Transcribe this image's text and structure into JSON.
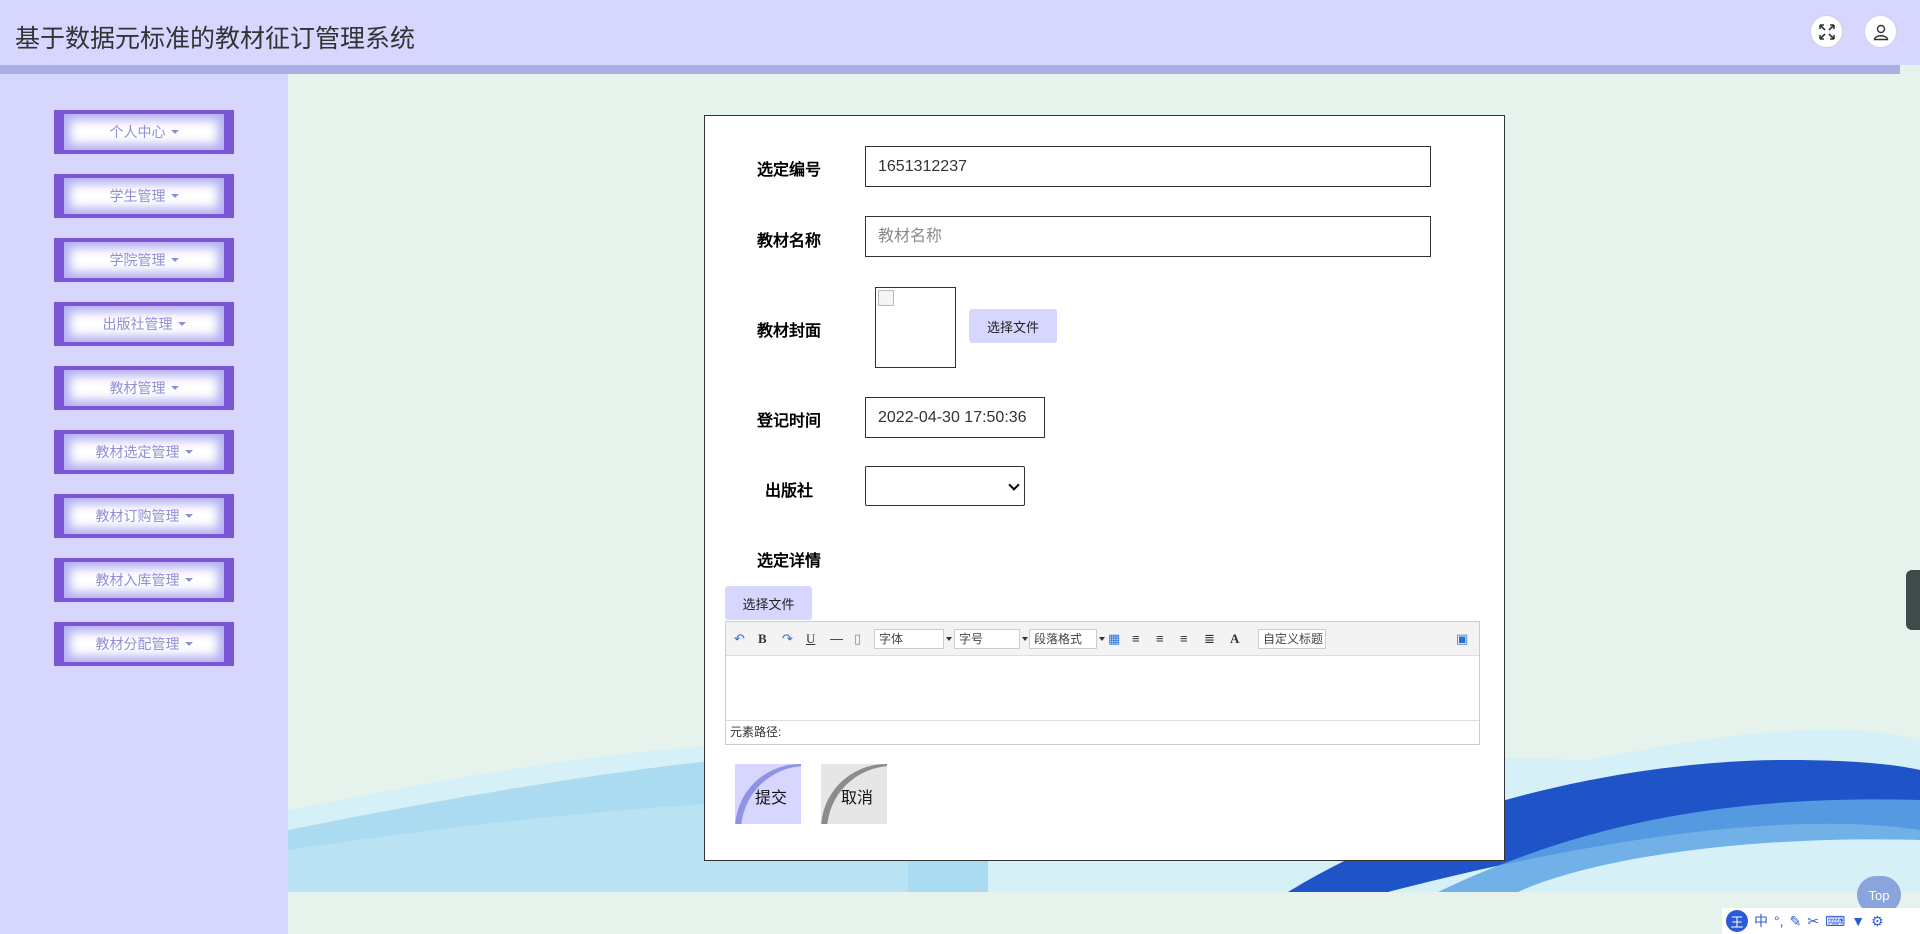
{
  "header": {
    "title": "基于数据元标准的教材征订管理系统",
    "fullscreen_icon": "expand-icon",
    "user_icon": "user-icon"
  },
  "sidebar": {
    "items": [
      {
        "label": "个人中心"
      },
      {
        "label": "学生管理"
      },
      {
        "label": "学院管理"
      },
      {
        "label": "出版社管理"
      },
      {
        "label": "教材管理"
      },
      {
        "label": "教材选定管理"
      },
      {
        "label": "教材订购管理"
      },
      {
        "label": "教材入库管理"
      },
      {
        "label": "教材分配管理"
      }
    ]
  },
  "form": {
    "selection_no": {
      "label": "选定编号",
      "value": "1651312237"
    },
    "textbook_name": {
      "label": "教材名称",
      "value": "",
      "placeholder": "教材名称"
    },
    "cover": {
      "label": "教材封面",
      "button": "选择文件"
    },
    "register_time": {
      "label": "登记时间",
      "value": "2022-04-30 17:50:36"
    },
    "publisher": {
      "label": "出版社",
      "value": ""
    },
    "details": {
      "label": "选定详情",
      "file_button": "选择文件",
      "toolbar": {
        "font": "字体",
        "size": "字号",
        "paragraph": "段落格式",
        "custom_heading": "自定义标题",
        "bold": "B",
        "underline": "U",
        "font_color": "A"
      },
      "element_path": "元素路径:"
    },
    "submit": "提交",
    "cancel": "取消"
  },
  "corner": {
    "top_button": "Top",
    "ime": {
      "logo": "王",
      "mode": "中"
    }
  },
  "colors": {
    "header_bg": "#d6d6fe",
    "menu_border": "#7b55d6",
    "menu_text": "#8f8fd8",
    "page_bg": "#e6f3ec",
    "submit_arc": "#8f93e6",
    "cancel_arc": "#8c8c8c"
  }
}
